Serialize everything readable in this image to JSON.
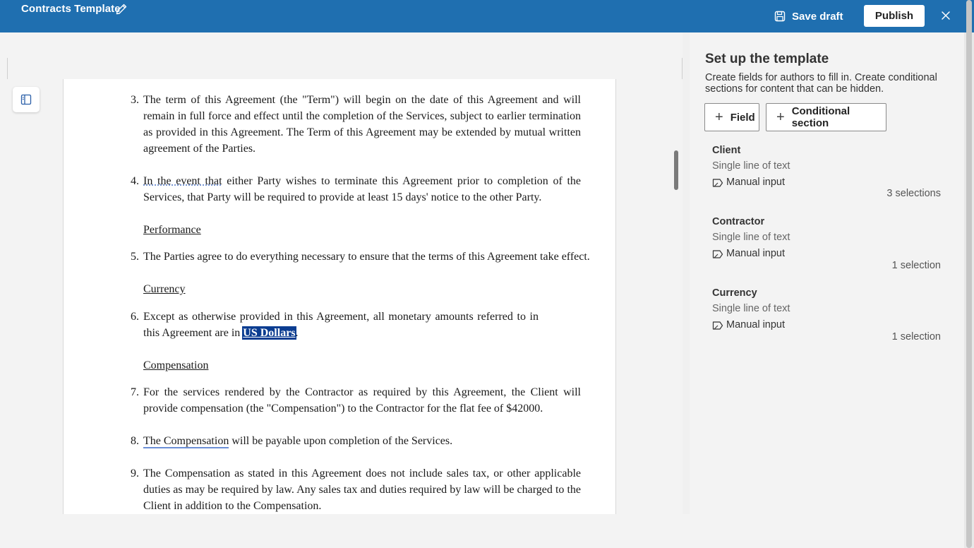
{
  "header": {
    "title": "Contracts Template",
    "save_draft": "Save draft",
    "publish": "Publish"
  },
  "document": {
    "items": [
      {
        "num": "3.",
        "text": "The term of this Agreement (the \"Term\") will begin on the date of this Agreement and will remain in full force and effect until the completion of the Services, subject to earlier termination as provided in this Agreement. The Term of this Agreement may be extended by mutual written agreement of the Parties."
      },
      {
        "num": "4.",
        "text_a": "In the event that",
        "text_b": " either Party wishes to terminate this Agreement prior to completion of the Services, that Party will be required to provide at least 15 days' notice to the other Party."
      },
      {
        "heading": "Performance"
      },
      {
        "num": "5.",
        "text": "The Parties agree to do everything necessary to ensure that the terms of this Agreement take effect."
      },
      {
        "heading": "Currency"
      },
      {
        "num": "6.",
        "text_a": "Except as otherwise provided in this Agreement, all monetary amounts referred to in this Agreement are in ",
        "highlight": "US Dollars",
        "text_b": "."
      },
      {
        "heading": "Compensation"
      },
      {
        "num": "7.",
        "text": "For the services rendered by the Contractor as required by this Agreement, the Client will provide compensation (the \"Compensation\") to the Contractor for the flat fee of $42000."
      },
      {
        "num": "8.",
        "text_a": "The Compensation",
        "text_b": " will be payable upon completion of the Services."
      },
      {
        "num": "9.",
        "text": "The Compensation as stated in this Agreement does not include sales tax, or other applicable duties as may be required by law. Any sales tax and duties required by law will be charged to the Client in addition to the Compensation."
      }
    ]
  },
  "panel": {
    "title": "Set up the template",
    "description": "Create fields for authors to fill in. Create conditional sections for content that can be hidden.",
    "field_button": "Field",
    "conditional_button": "Conditional section",
    "fields": [
      {
        "name": "Client",
        "type": "Single line of text",
        "input": "Manual input",
        "selections": "3 selections"
      },
      {
        "name": "Contractor",
        "type": "Single line of text",
        "input": "Manual input",
        "selections": "1 selection"
      },
      {
        "name": "Currency",
        "type": "Single line of text",
        "input": "Manual input",
        "selections": "1 selection"
      }
    ]
  },
  "icons": {
    "edit": "pencil-icon",
    "save": "save-icon",
    "close": "close-icon",
    "nav": "navigation-pane-icon",
    "plus": "plus-icon",
    "tag": "tag-icon"
  },
  "colors": {
    "header_bg": "#1f6fb0",
    "highlight_bg": "#0b3d91"
  }
}
